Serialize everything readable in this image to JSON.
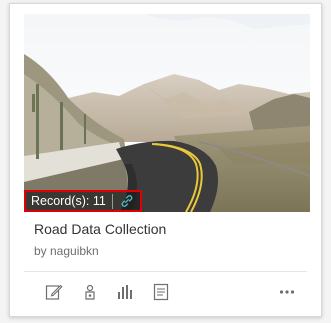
{
  "card": {
    "record_label": "Record(s): 11",
    "title": "Road Data Collection",
    "owner": "by naguibkn"
  },
  "icons": {
    "link": "link-icon",
    "edit": "edit-icon",
    "tag": "tag-icon",
    "chart": "bar-chart-icon",
    "details": "details-icon",
    "more": "more-icon"
  },
  "colors": {
    "highlight": "#e00000",
    "icon": "#6e6e6e",
    "link_icon": "#4db8c4"
  }
}
